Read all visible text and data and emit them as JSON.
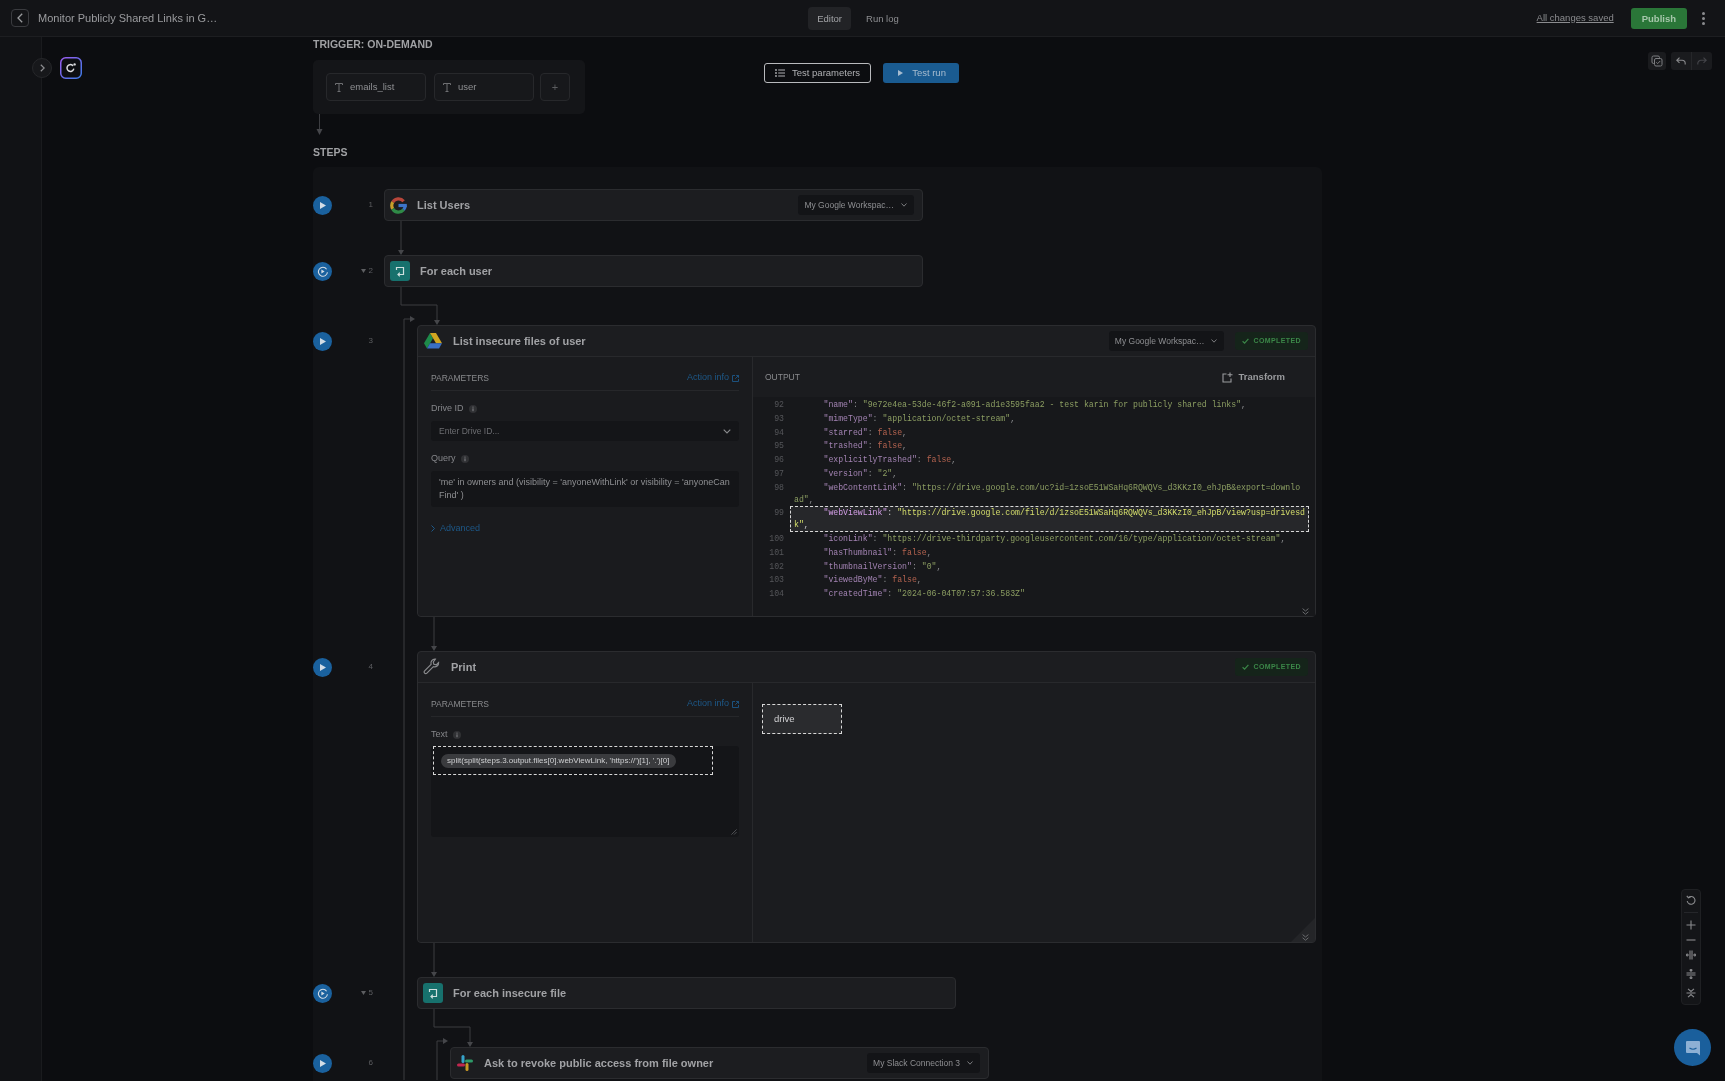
{
  "header": {
    "title": "Monitor Publicly Shared Links in G…",
    "tabs": [
      {
        "label": "Editor",
        "selected": true
      },
      {
        "label": "Run log",
        "selected": false
      }
    ],
    "save_status": "All changes saved",
    "publish_button": "Publish"
  },
  "sidebar": {
    "collapsed": true
  },
  "trigger": {
    "title": "TRIGGER: ON-DEMAND",
    "parameters": [
      {
        "name": "emails_list"
      },
      {
        "name": "user"
      }
    ],
    "add_button": "+"
  },
  "run_controls": {
    "test_parameters_button": "Test parameters",
    "test_run_button": "Test run"
  },
  "canvas_tools": {
    "undo_enabled": true,
    "redo_enabled": false
  },
  "steps_title": "STEPS",
  "steps": [
    {
      "kind": "google",
      "number": "1",
      "title": "List Users",
      "connection": "My Google Workspac…"
    },
    {
      "kind": "loop",
      "number": "2",
      "title": "For each user",
      "expanded": true,
      "children": [
        {
          "kind": "drive",
          "number": "3",
          "title": "List insecure files of user",
          "connection": "My Google Workspac…",
          "status": "COMPLETED",
          "parameters": {
            "title": "PARAMETERS",
            "action_info": "Action info",
            "fields": [
              {
                "kind": "select",
                "label": "Drive ID",
                "placeholder": "Enter Drive ID...",
                "highlighted": false
              },
              {
                "kind": "text",
                "label": "Query",
                "value": "'me' in owners and (visibility = 'anyoneWithLink' or visibility = 'anyoneCanFind' )",
                "highlighted": false
              }
            ],
            "advanced": {
              "label": "Advanced",
              "expanded": false
            }
          },
          "output": {
            "kind": "json",
            "title": "OUTPUT",
            "transform_button": "Transform",
            "lines": [
              {
                "number": "92",
                "text": "\"name\": \"9e72e4ea-53de-46f2-a091-ad1e3595faa2 - test karin for publicly shared links\",",
                "highlighted": false
              },
              {
                "number": "93",
                "text": "\"mimeType\": \"application/octet-stream\",",
                "highlighted": false
              },
              {
                "number": "94",
                "text": "\"starred\": false,",
                "highlighted": false
              },
              {
                "number": "95",
                "text": "\"trashed\": false,",
                "highlighted": false
              },
              {
                "number": "96",
                "text": "\"explicitlyTrashed\": false,",
                "highlighted": false
              },
              {
                "number": "97",
                "text": "\"version\": \"2\",",
                "highlighted": false
              },
              {
                "number": "98",
                "text": "\"webContentLink\": \"https://drive.google.com/uc?id=1zsoE51WSaHq6RQWQVs_d3KKzI0_ehJpB&export=download\",",
                "highlighted": false
              },
              {
                "number": "99",
                "text": "\"webViewLink\": \"https://drive.google.com/file/d/1zsoE51WSaHq6RQWQVs_d3KKzI0_ehJpB/view?usp=drivesdk\",",
                "highlighted": true
              },
              {
                "number": "100",
                "text": "\"iconLink\": \"https://drive-thirdparty.googleusercontent.com/16/type/application/octet-stream\",",
                "highlighted": false
              },
              {
                "number": "101",
                "text": "\"hasThumbnail\": false,",
                "highlighted": false
              },
              {
                "number": "102",
                "text": "\"thumbnailVersion\": \"0\",",
                "highlighted": false
              },
              {
                "number": "103",
                "text": "\"viewedByMe\": false,",
                "highlighted": false
              },
              {
                "number": "104",
                "text": "\"createdTime\": \"2024-06-04T07:57:36.583Z\"",
                "highlighted": false
              }
            ]
          }
        },
        {
          "kind": "print",
          "number": "4",
          "title": "Print",
          "status": "COMPLETED",
          "parameters": {
            "title": "PARAMETERS",
            "action_info": "Action info",
            "fields": [
              {
                "kind": "expression",
                "label": "Text",
                "value": "split(split(steps.3.output.files[0].webViewLink, 'https://')[1], '.')[0]",
                "highlighted": true
              }
            ]
          },
          "output": {
            "kind": "text",
            "result": "drive",
            "highlighted": true
          }
        },
        {
          "kind": "loop",
          "number": "5",
          "title": "For each insecure file",
          "expanded": true,
          "children": [
            {
              "kind": "slack",
              "number": "6",
              "title": "Ask to revoke public access from file owner",
              "connection": "My Slack Connection 3"
            }
          ]
        }
      ]
    }
  ]
}
